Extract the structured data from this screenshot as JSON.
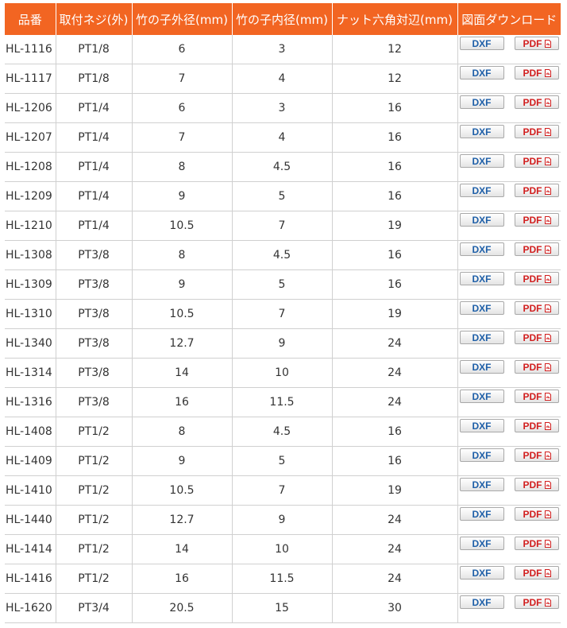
{
  "table": {
    "headers": [
      "品番",
      "取付ネジ(外)",
      "竹の子外径(mm)",
      "竹の子内径(mm)",
      "ナット六角対辺(mm)",
      "図面ダウンロード"
    ],
    "dxf_label": "DXF",
    "pdf_label": "PDF",
    "colors": {
      "header_bg": "#f26522",
      "dxf_text": "#1e5fa8",
      "pdf_text": "#d21f1f"
    },
    "icons": {
      "pdf": "pdf-file-icon"
    },
    "rows": [
      [
        "HL-1116",
        "PT1/8",
        "6",
        "3",
        "12"
      ],
      [
        "HL-1117",
        "PT1/8",
        "7",
        "4",
        "12"
      ],
      [
        "HL-1206",
        "PT1/4",
        "6",
        "3",
        "16"
      ],
      [
        "HL-1207",
        "PT1/4",
        "7",
        "4",
        "16"
      ],
      [
        "HL-1208",
        "PT1/4",
        "8",
        "4.5",
        "16"
      ],
      [
        "HL-1209",
        "PT1/4",
        "9",
        "5",
        "16"
      ],
      [
        "HL-1210",
        "PT1/4",
        "10.5",
        "7",
        "19"
      ],
      [
        "HL-1308",
        "PT3/8",
        "8",
        "4.5",
        "16"
      ],
      [
        "HL-1309",
        "PT3/8",
        "9",
        "5",
        "16"
      ],
      [
        "HL-1310",
        "PT3/8",
        "10.5",
        "7",
        "19"
      ],
      [
        "HL-1340",
        "PT3/8",
        "12.7",
        "9",
        "24"
      ],
      [
        "HL-1314",
        "PT3/8",
        "14",
        "10",
        "24"
      ],
      [
        "HL-1316",
        "PT3/8",
        "16",
        "11.5",
        "24"
      ],
      [
        "HL-1408",
        "PT1/2",
        "8",
        "4.5",
        "16"
      ],
      [
        "HL-1409",
        "PT1/2",
        "9",
        "5",
        "16"
      ],
      [
        "HL-1410",
        "PT1/2",
        "10.5",
        "7",
        "19"
      ],
      [
        "HL-1440",
        "PT1/2",
        "12.7",
        "9",
        "24"
      ],
      [
        "HL-1414",
        "PT1/2",
        "14",
        "10",
        "24"
      ],
      [
        "HL-1416",
        "PT1/2",
        "16",
        "11.5",
        "24"
      ],
      [
        "HL-1620",
        "PT3/4",
        "20.5",
        "15",
        "30"
      ]
    ]
  }
}
